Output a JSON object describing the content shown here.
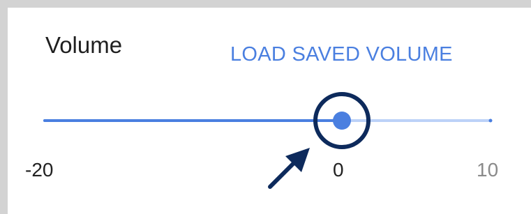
{
  "volume": {
    "label": "Volume",
    "load_button_label": "LOAD SAVED VOLUME",
    "min_label": "-20",
    "current_label": "0",
    "max_label": "10",
    "min": -20,
    "max": 10,
    "value": 0
  },
  "colors": {
    "accent": "#4a7fe0",
    "track_inactive": "#bcd2f8",
    "highlight_circle": "#0d2a5c",
    "arrow": "#0d2a5c"
  },
  "icons": {
    "annotation_circle": "highlight-circle-icon",
    "annotation_arrow": "pointer-arrow-icon"
  }
}
